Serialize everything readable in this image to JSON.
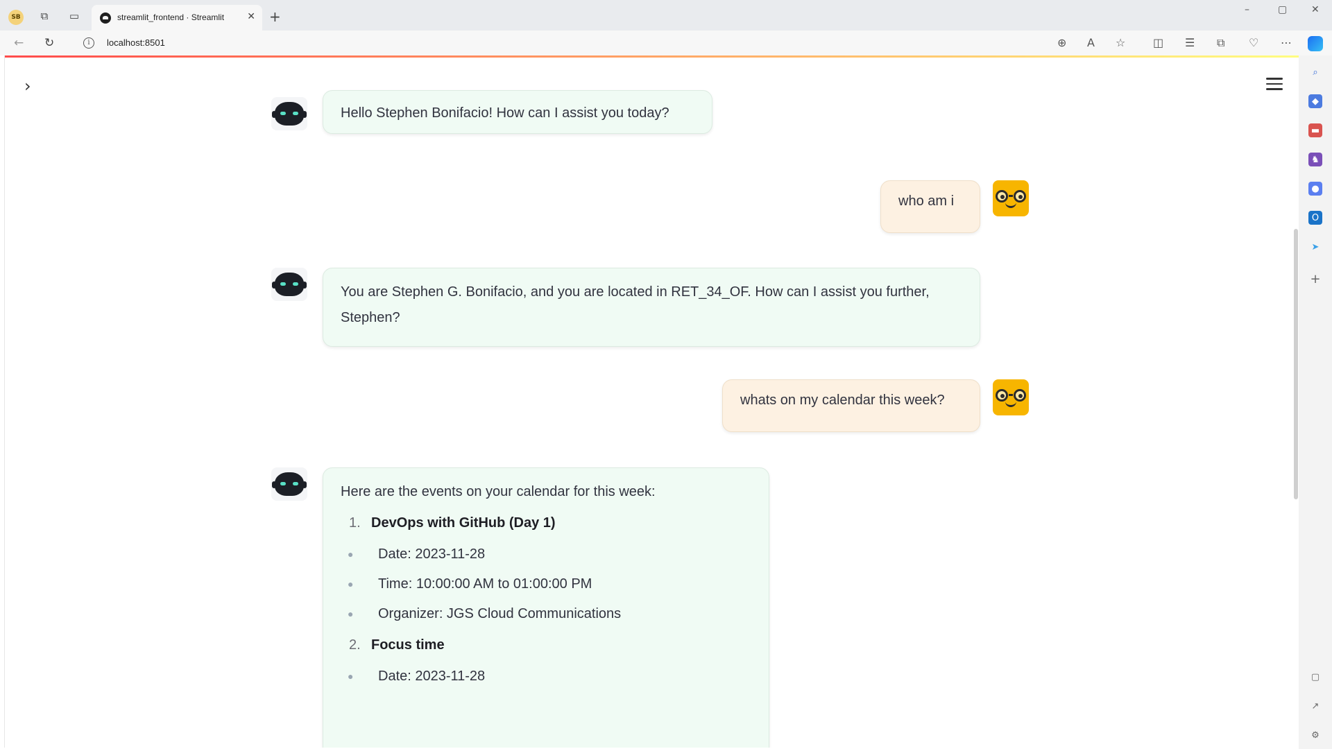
{
  "browser": {
    "profile_initials": "SB",
    "tab_title": "streamlit_frontend · Streamlit",
    "url": "localhost:8501"
  },
  "chat": {
    "messages": [
      {
        "role": "assistant",
        "text": "Hello Stephen Bonifacio! How can I assist you today?"
      },
      {
        "role": "user",
        "text": "who am i"
      },
      {
        "role": "assistant",
        "text": "You are Stephen G. Bonifacio, and you are located in RET_34_OF. How can I assist you further, Stephen?"
      },
      {
        "role": "user",
        "text": "whats on my calendar this week?"
      }
    ],
    "events_reply": {
      "intro": "Here are the events on your calendar for this week:",
      "events": [
        {
          "number": "1.",
          "title": "DevOps with GitHub (Day 1)",
          "date": "Date: 2023-11-28",
          "time": "Time: 10:00:00 AM to 01:00:00 PM",
          "organizer": "Organizer: JGS Cloud Communications"
        },
        {
          "number": "2.",
          "title": "Focus time",
          "date": "Date: 2023-11-28"
        }
      ]
    }
  },
  "colors": {
    "assistant_bubble": "#f0fbf4",
    "user_bubble": "#fdf1e2",
    "user_avatar": "#f7b500",
    "decoration_start": "#ff4b4b",
    "decoration_end": "#fffd80"
  }
}
